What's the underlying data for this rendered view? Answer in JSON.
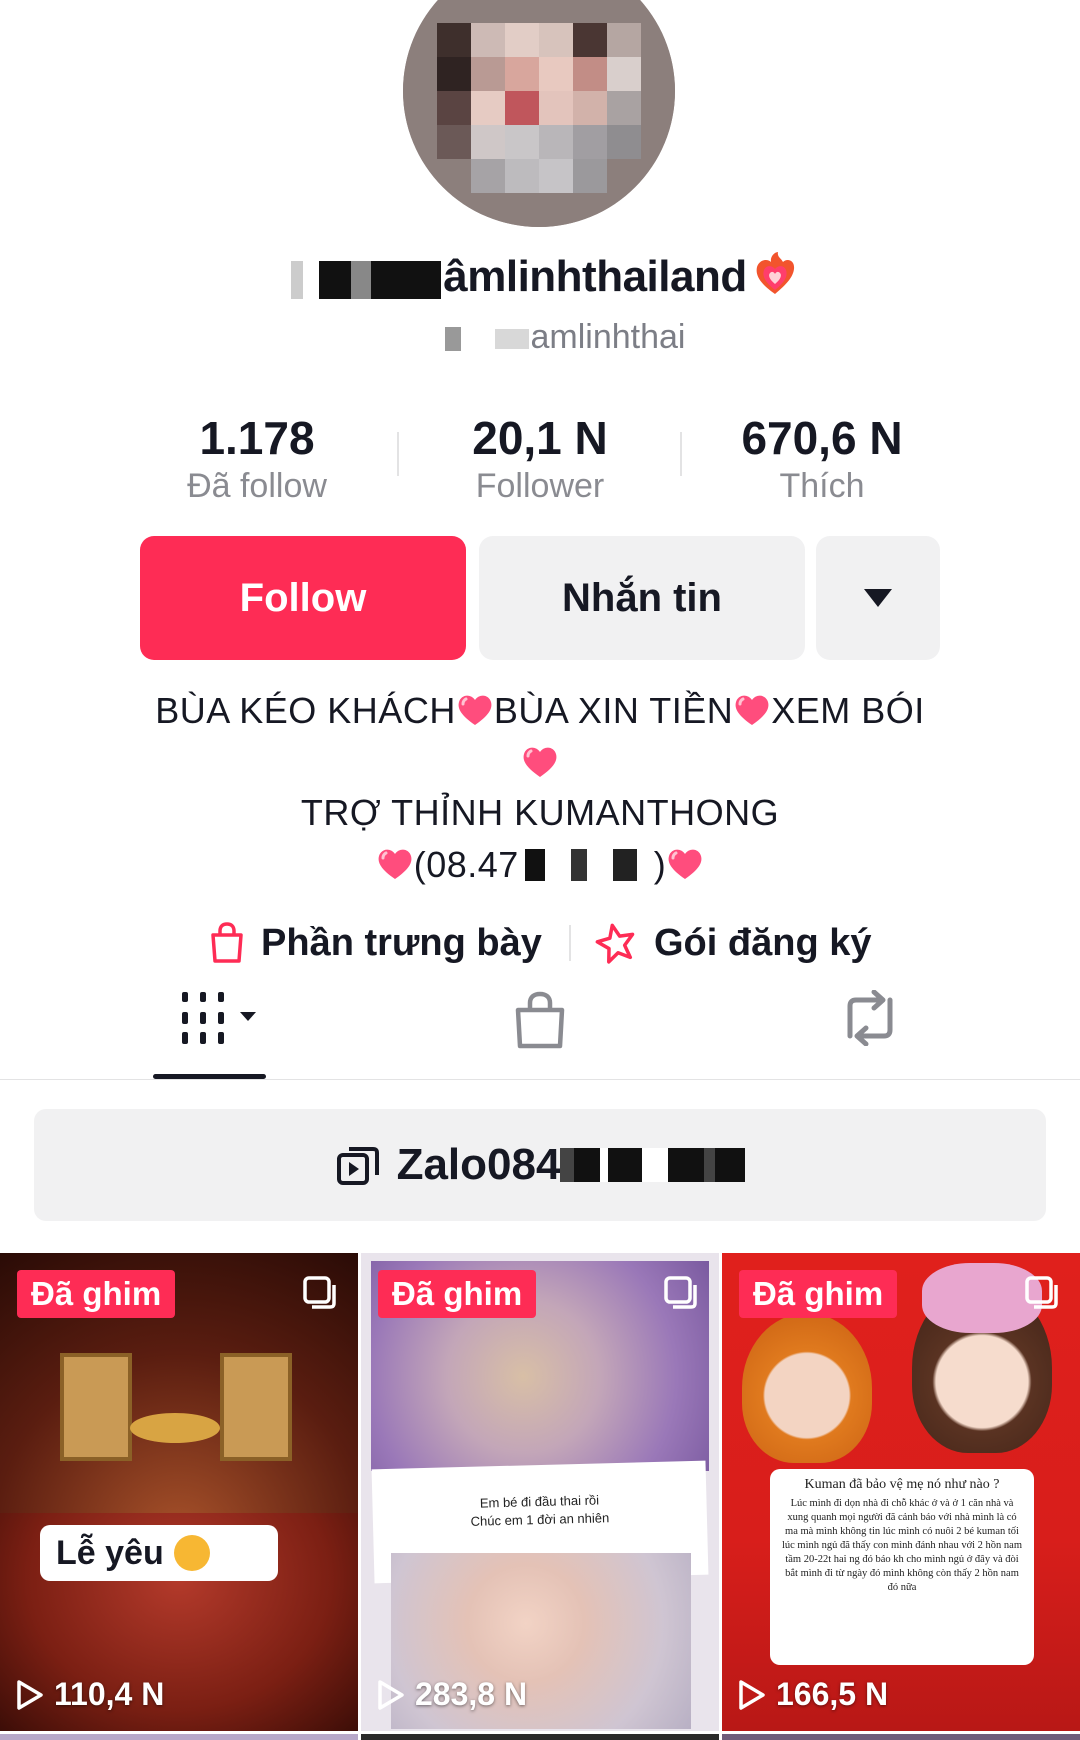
{
  "profile": {
    "username_visible": "âmlinhthailand",
    "handle_visible": "amlinhthai"
  },
  "stats": [
    {
      "value": "1.178",
      "label": "Đã follow"
    },
    {
      "value": "20,1 N",
      "label": "Follower"
    },
    {
      "value": "670,6 N",
      "label": "Thích"
    }
  ],
  "actions": {
    "follow_label": "Follow",
    "message_label": "Nhắn tin"
  },
  "bio": {
    "line1a": "BÙA KÉO KHÁCH",
    "line1b": "BÙA XIN TIỀN",
    "line1c": "XEM BÓI",
    "line3": "TRỢ THỈNH KUMANTHONG",
    "line4a": "(08.47",
    "line4b": ")"
  },
  "links": {
    "showcase": "Phần trưng bày",
    "subscription": "Gói đăng ký"
  },
  "zalo": {
    "text": "Zalo084"
  },
  "videos": [
    {
      "pinned": "Đã ghim",
      "views": "110,4 N",
      "caption": "Lễ yêu"
    },
    {
      "pinned": "Đã ghim",
      "views": "283,8 N",
      "caption_line1": "Em bé đi đầu thai rồi",
      "caption_line2": "Chúc em 1 đời an nhiên"
    },
    {
      "pinned": "Đã ghim",
      "views": "166,5 N",
      "caption_title": "Kuman đã bảo vệ mẹ nó như nào ?",
      "caption_body": "Lúc mình đi dọn nhà đi chỗ khác ở và ở 1 căn nhà và xung quanh mọi người đã cảnh báo với nhà mình là có ma mà mình không tin lúc mình có nuôi 2 bé kuman tối lúc mình ngủ đã thấy con mình đánh nhau với 2 hồn nam tầm 20-22t hai ng đó báo kh cho mình ngủ ở đây và đòi bắt mình đi từ ngày đó mình không còn thấy 2 hồn nam đó nữa"
    }
  ],
  "colors": {
    "accent": "#fe2c55",
    "text": "#161823",
    "muted": "#8a8b91",
    "surface": "#f1f1f2"
  }
}
